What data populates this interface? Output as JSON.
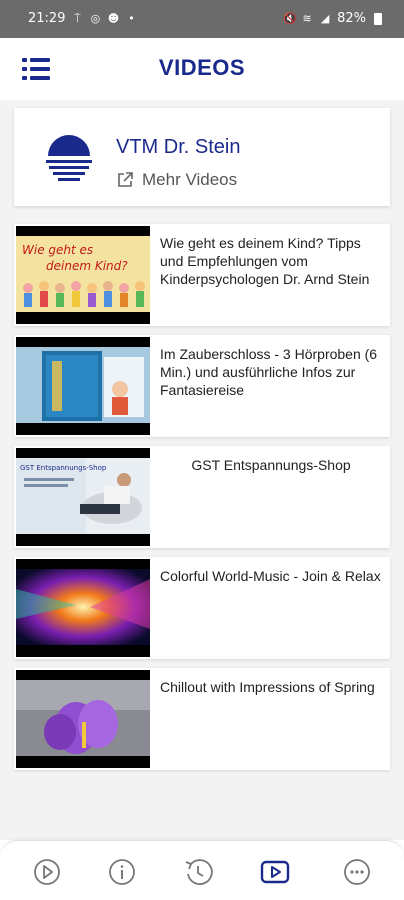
{
  "status_bar": {
    "time": "21:29",
    "battery": "82%"
  },
  "header": {
    "title": "VIDEOS"
  },
  "channel": {
    "name": "VTM Dr. Stein",
    "more_videos_label": "Mehr Videos"
  },
  "videos": [
    {
      "title": "Wie geht es deinem Kind?  Tipps und Empfehlungen vom Kinderpsychologen  Dr. Arnd Stein",
      "thumb_text_line1": "Wie geht es",
      "thumb_text_line2": "deinem Kind?"
    },
    {
      "title": "Im Zauberschloss - 3 Hörproben (6 Min.) und ausführliche Infos zur Fantasiereise"
    },
    {
      "title": "GST Entspannungs-Shop",
      "thumb_text_line1": "GST Entspannungs-Shop"
    },
    {
      "title": "Colorful World-Music - Join & Relax"
    },
    {
      "title": "Chillout with Impressions of Spring"
    }
  ],
  "bottom_nav": {
    "items": [
      {
        "icon": "play-circle-icon",
        "active": false
      },
      {
        "icon": "info-icon",
        "active": false
      },
      {
        "icon": "history-icon",
        "active": false
      },
      {
        "icon": "video-play-icon",
        "active": true
      },
      {
        "icon": "more-icon",
        "active": false
      }
    ]
  },
  "colors": {
    "brand_navy": "#1a2a8c",
    "status_bar": "#6b6b6b",
    "background": "#f3f3f3"
  }
}
